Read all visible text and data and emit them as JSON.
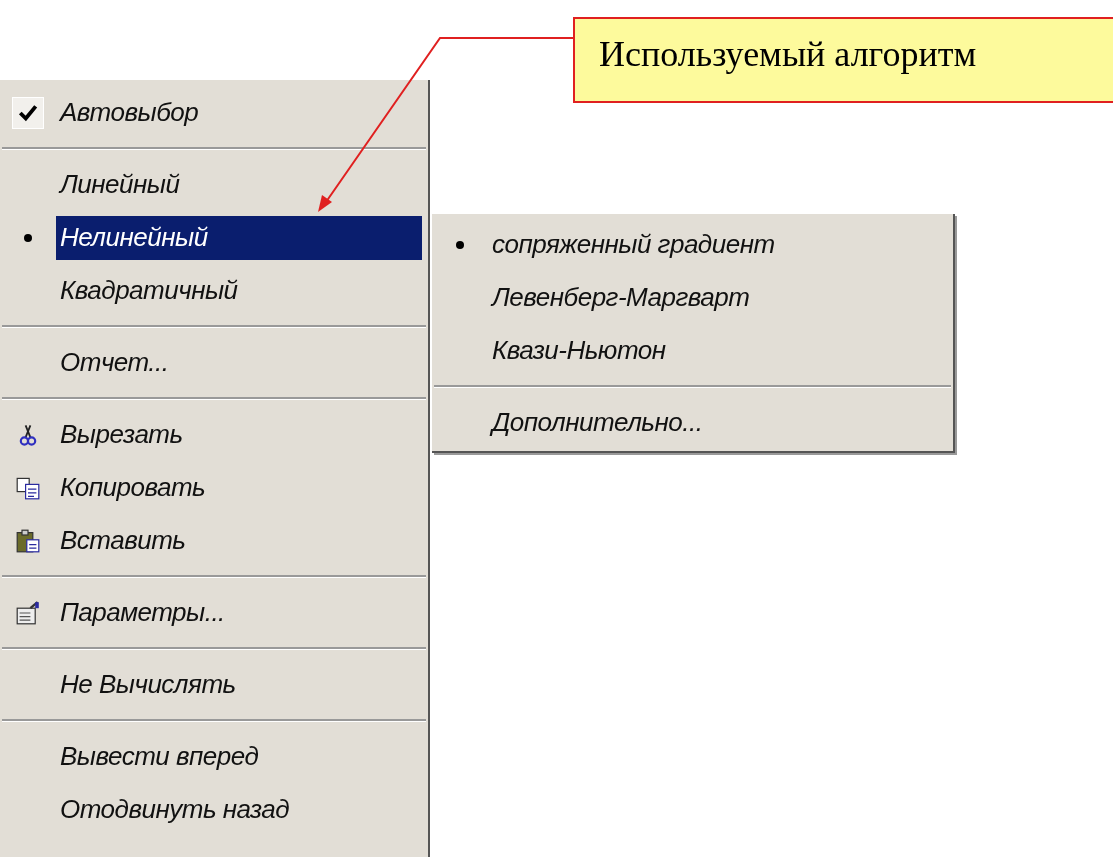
{
  "callout": {
    "text": "Используемый алгоритм"
  },
  "context_menu": {
    "items": [
      {
        "kind": "check",
        "label": "Автовыбор",
        "checked": true,
        "selected": false
      },
      {
        "kind": "separator"
      },
      {
        "kind": "radio",
        "label": "Линейный",
        "checked": false,
        "selected": false
      },
      {
        "kind": "radio",
        "label": "Нелинейный",
        "checked": true,
        "selected": true,
        "submenu": true
      },
      {
        "kind": "radio",
        "label": "Квадратичный",
        "checked": false,
        "selected": false
      },
      {
        "kind": "separator"
      },
      {
        "kind": "command",
        "label": "Отчет...",
        "selected": false
      },
      {
        "kind": "separator"
      },
      {
        "kind": "cut",
        "label": "Вырезать",
        "selected": false
      },
      {
        "kind": "copy",
        "label": "Копировать",
        "selected": false
      },
      {
        "kind": "paste",
        "label": "Вставить",
        "selected": false
      },
      {
        "kind": "separator"
      },
      {
        "kind": "properties",
        "label": "Параметры...",
        "selected": false
      },
      {
        "kind": "separator"
      },
      {
        "kind": "command",
        "label": "Не Вычислять",
        "selected": false
      },
      {
        "kind": "separator"
      },
      {
        "kind": "command",
        "label": "Вывести вперед",
        "selected": false
      },
      {
        "kind": "command",
        "label": "Отодвинуть назад",
        "selected": false
      }
    ]
  },
  "submenu": {
    "items": [
      {
        "kind": "radio",
        "label": "сопряженный градиент",
        "checked": true,
        "selected": false
      },
      {
        "kind": "radio",
        "label": "Левенберг-Маргварт",
        "checked": false,
        "selected": false
      },
      {
        "kind": "radio",
        "label": "Квази-Ньютон",
        "checked": false,
        "selected": false
      },
      {
        "kind": "separator"
      },
      {
        "kind": "command",
        "label": "Дополнительно...",
        "selected": false
      }
    ]
  }
}
